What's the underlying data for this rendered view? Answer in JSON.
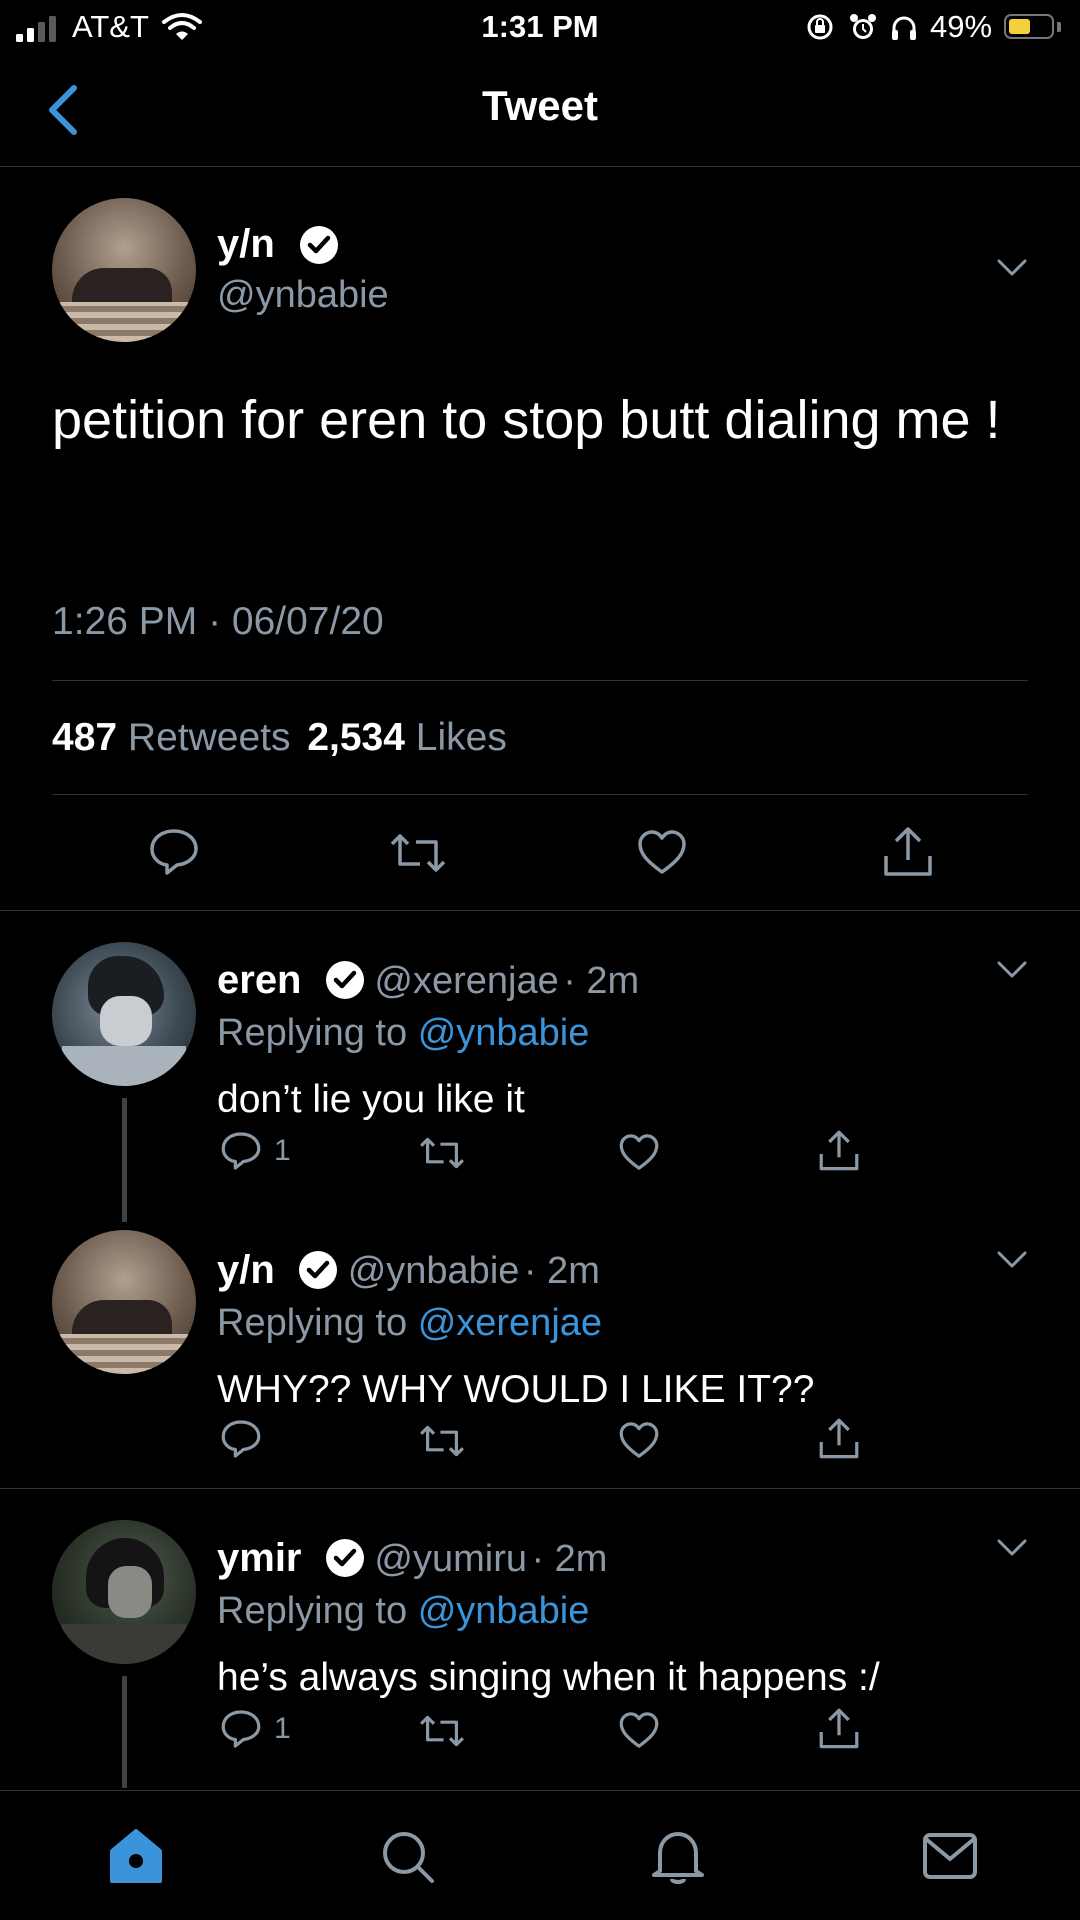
{
  "status_bar": {
    "carrier": "AT&T",
    "time": "1:31 PM",
    "battery_percent": "49%",
    "battery_level": 0.49
  },
  "header": {
    "title": "Tweet"
  },
  "main_tweet": {
    "name": "y/n",
    "handle": "@ynbabie",
    "text": "petition for eren to stop butt dialing me !",
    "timestamp": "1:26 PM · 06/07/20",
    "retweets_count": "487",
    "retweets_label": "Retweets",
    "likes_count": "2,534",
    "likes_label": "Likes"
  },
  "replies": [
    {
      "name": "eren",
      "handle": "@xerenjae",
      "time": "· 2m",
      "replying_prefix": "Replying to",
      "replying_to": "@ynbabie",
      "text": "don’t lie you like it",
      "reply_count": "1"
    },
    {
      "name": "y/n",
      "handle": "@ynbabie",
      "time": "· 2m",
      "replying_prefix": "Replying to",
      "replying_to": "@xerenjae",
      "text": "WHY?? WHY WOULD I LIKE IT??",
      "reply_count": ""
    },
    {
      "name": "ymir",
      "handle": "@yumiru",
      "time": "· 2m",
      "replying_prefix": "Replying to",
      "replying_to": "@ynbabie",
      "text": "he’s always singing when it happens :/",
      "reply_count": "1"
    }
  ],
  "colors": {
    "accent": "#3b94d9",
    "secondary_text": "#8b98a5",
    "divider": "#2f3336",
    "battery": "#f5cf3c"
  }
}
